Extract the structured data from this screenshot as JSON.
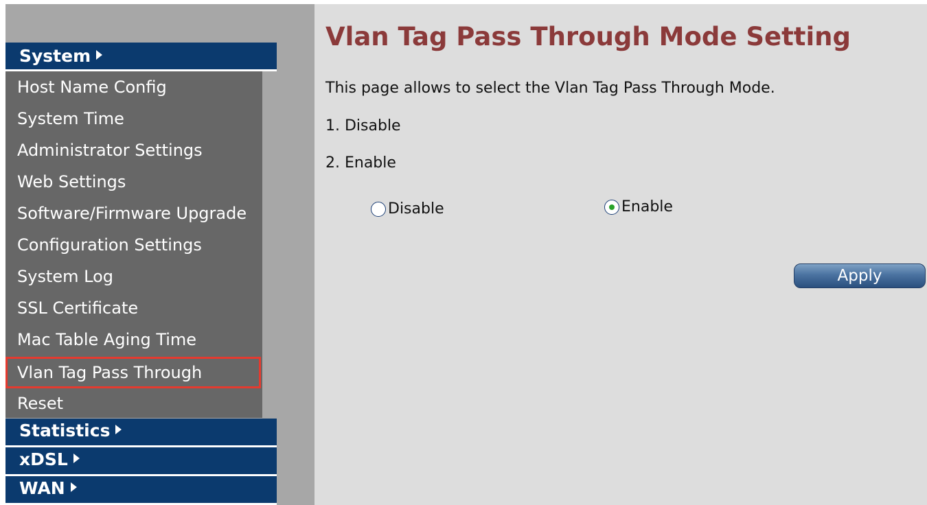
{
  "sidebar": {
    "sections": {
      "system": "System",
      "statistics": "Statistics",
      "xdsl": "xDSL",
      "wan": "WAN"
    },
    "system_items": [
      "Host Name Config",
      "System Time",
      "Administrator Settings",
      "Web Settings",
      "Software/Firmware Upgrade",
      "Configuration Settings",
      "System Log",
      "SSL Certificate",
      "Mac Table Aging Time",
      "Vlan Tag Pass Through",
      "Reset"
    ],
    "active_item": "Vlan Tag Pass Through"
  },
  "main": {
    "title": "Vlan Tag Pass Through Mode Setting",
    "description": "This page allows to select the Vlan Tag Pass Through Mode.",
    "options_list": [
      "1. Disable",
      "2. Enable"
    ],
    "radio": {
      "disable_label": "Disable",
      "enable_label": "Enable",
      "selected": "Enable"
    },
    "apply_label": "Apply"
  },
  "colors": {
    "header_blue": "#0b3a6e",
    "menu_gray": "#676767",
    "title_red": "#8b3a3a",
    "highlight_red": "#e53a2f",
    "content_bg": "#dddddd"
  },
  "icons": {
    "section_arrow": "triangle-right-icon"
  }
}
